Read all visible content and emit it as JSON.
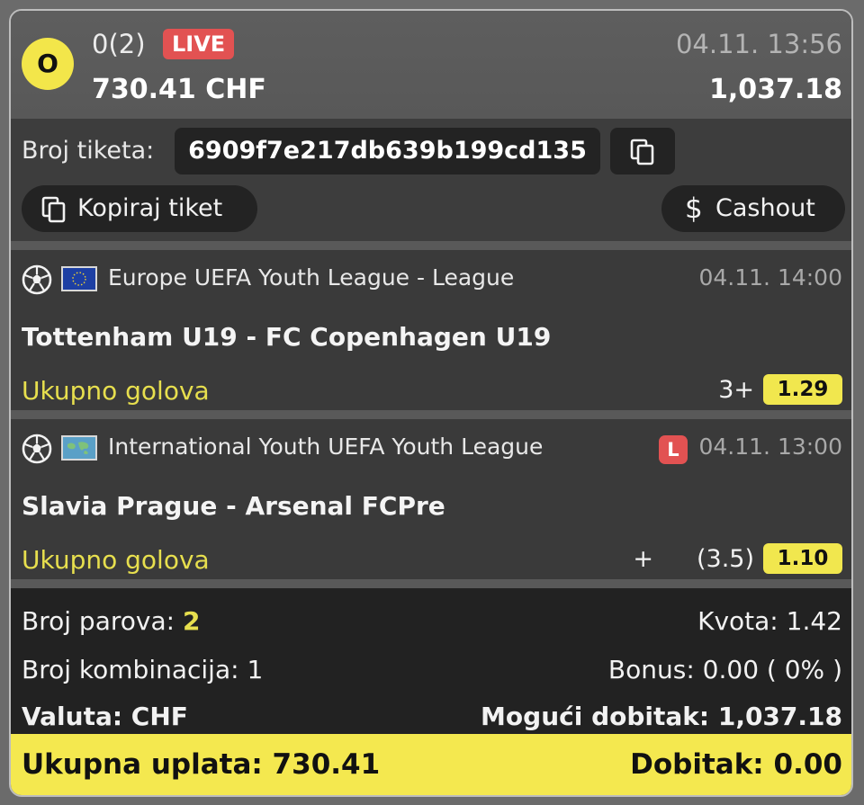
{
  "header": {
    "status_letter": "O",
    "bet_count": "0(2)",
    "live_label": "LIVE",
    "placed_time": "04.11. 13:56",
    "stake": "730.41 CHF",
    "payout": "1,037.18"
  },
  "ticket": {
    "label": "Broj tiketa:",
    "id": "6909f7e217db639b199cd135",
    "copy_ticket_label": "Kopiraj tiket",
    "cashout_label": "Cashout"
  },
  "matches": [
    {
      "league": "Europe UEFA Youth League - League",
      "time": "04.11. 14:00",
      "live": false,
      "teams": "Tottenham U19 - FC Copenhagen U19",
      "market": "Ukupno golova",
      "pick_sign": "",
      "pick": "3+",
      "odd": "1.29"
    },
    {
      "league": "International Youth UEFA Youth League",
      "time": "04.11. 13:00",
      "live": true,
      "live_mark": "L",
      "teams": "Slavia Prague - Arsenal FCPre",
      "market": "Ukupno golova",
      "pick_sign": "+",
      "pick": "(3.5)",
      "odd": "1.10"
    }
  ],
  "summary": {
    "pairs_label": "Broj parova:",
    "pairs_value": "2",
    "odds_label": "Kvota: 1.42",
    "combos_label": "Broj kombinacija: 1",
    "bonus_label": "Bonus: 0.00 ( 0% )",
    "currency_label": "Valuta: CHF",
    "possible_win_label": "Mogući dobitak: 1,037.18"
  },
  "footer": {
    "total_stake": "Ukupna uplata: 730.41",
    "win": "Dobitak: 0.00"
  },
  "colors": {
    "accent_yellow": "#f1e74e",
    "live_red": "#e25252",
    "market_yellow": "#e7df4e"
  }
}
